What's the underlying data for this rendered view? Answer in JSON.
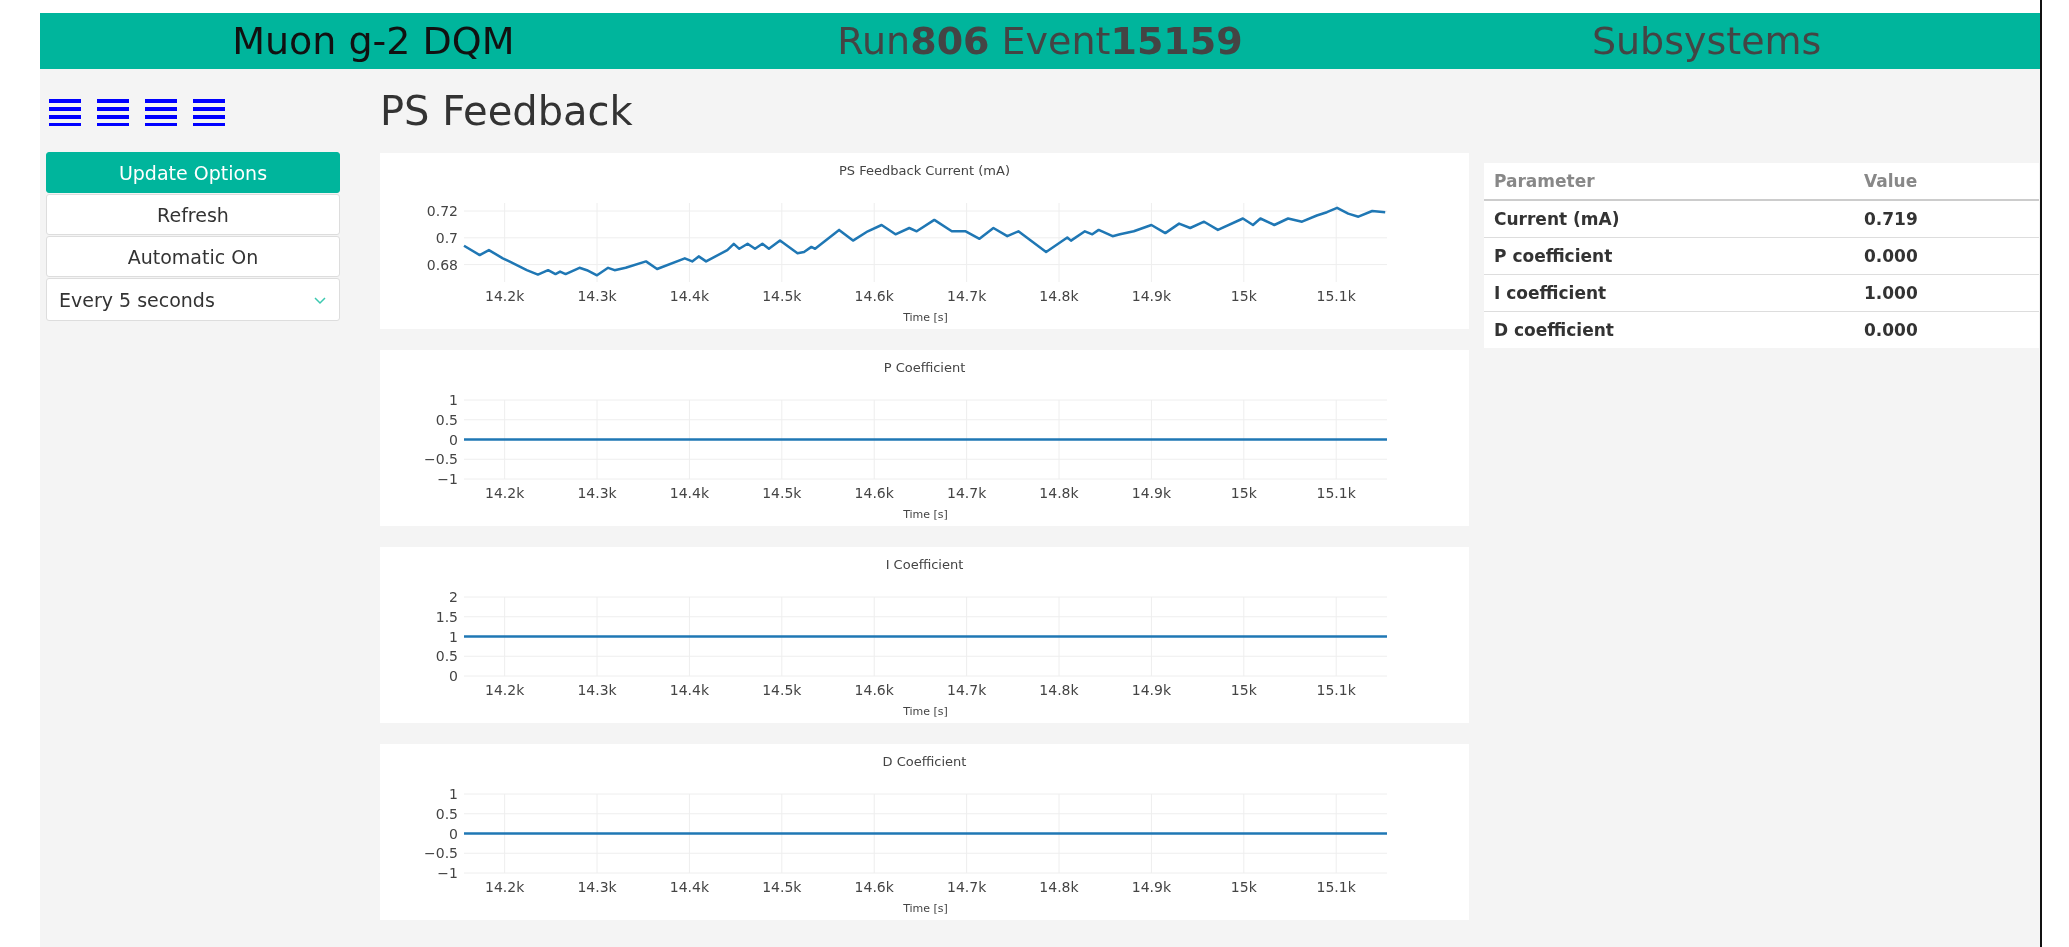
{
  "header": {
    "title": "Muon g-2 DQM",
    "run_event": "Run**806** Event**15159**",
    "subsystems": "Subsystems"
  },
  "sidebar": {
    "buttons": [
      {
        "label": "Update Options",
        "kind": "primary"
      },
      {
        "label": "Refresh",
        "kind": "plain"
      },
      {
        "label": "Automatic On",
        "kind": "plain"
      }
    ],
    "interval_select": {
      "value": "Every 5 seconds"
    }
  },
  "page_title": "PS Feedback",
  "charts": [
    {
      "chart_data": {
        "type": "line",
        "grid": true,
        "title": "PS Feedback Current (mA)",
        "xlabel": "Time [s]",
        "xlim": [
          14156,
          15155
        ],
        "ylim": [
          0.667,
          0.726
        ],
        "xticks": [
          {
            "value": 14200,
            "label": "14.2k"
          },
          {
            "value": 14300,
            "label": "14.3k"
          },
          {
            "value": 14400,
            "label": "14.4k"
          },
          {
            "value": 14500,
            "label": "14.5k"
          },
          {
            "value": 14600,
            "label": "14.6k"
          },
          {
            "value": 14700,
            "label": "14.7k"
          },
          {
            "value": 14800,
            "label": "14.8k"
          },
          {
            "value": 14900,
            "label": "14.9k"
          },
          {
            "value": 15000,
            "label": "15k"
          },
          {
            "value": 15100,
            "label": "15.1k"
          }
        ],
        "yticks": [
          {
            "value": 0.68,
            "label": "0.68"
          },
          {
            "value": 0.7,
            "label": "0.7"
          },
          {
            "value": 0.72,
            "label": "0.72"
          }
        ],
        "x": [
          14156,
          14173,
          14183,
          14198,
          14205,
          14224,
          14236,
          14247,
          14255,
          14260,
          14266,
          14281,
          14289,
          14300,
          14312,
          14319,
          14331,
          14353,
          14365,
          14395,
          14403,
          14410,
          14418,
          14441,
          14448,
          14454,
          14463,
          14471,
          14479,
          14486,
          14498,
          14517,
          14524,
          14532,
          14536,
          14562,
          14577,
          14593,
          14608,
          14623,
          14638,
          14646,
          14665,
          14684,
          14699,
          14714,
          14729,
          14744,
          14756,
          14786,
          14809,
          14813,
          14828,
          14836,
          14843,
          14858,
          14866,
          14881,
          14900,
          14915,
          14930,
          14942,
          14957,
          14972,
          14999,
          15010,
          15018,
          15033,
          15048,
          15063,
          15079,
          15090,
          15101,
          15113,
          15124,
          15139,
          15153
        ],
        "series": [
          {
            "color": "#1f77b4",
            "values": [
              0.6941,
              0.6871,
              0.6908,
              0.6847,
              0.6824,
              0.6758,
              0.6725,
              0.6758,
              0.6729,
              0.6748,
              0.6729,
              0.6776,
              0.6758,
              0.672,
              0.6776,
              0.6758,
              0.6776,
              0.6824,
              0.6767,
              0.6847,
              0.6824,
              0.6861,
              0.6824,
              0.6908,
              0.6955,
              0.6918,
              0.6955,
              0.6918,
              0.6955,
              0.6918,
              0.6979,
              0.6885,
              0.6894,
              0.6932,
              0.6918,
              0.7059,
              0.6979,
              0.7049,
              0.7096,
              0.7026,
              0.7073,
              0.7049,
              0.7134,
              0.7049,
              0.7049,
              0.6993,
              0.7073,
              0.7012,
              0.7049,
              0.6894,
              0.7002,
              0.6979,
              0.7049,
              0.7026,
              0.7059,
              0.7012,
              0.7026,
              0.7049,
              0.7096,
              0.7035,
              0.7106,
              0.7073,
              0.712,
              0.7059,
              0.7144,
              0.7096,
              0.7144,
              0.7096,
              0.7144,
              0.712,
              0.7167,
              0.7191,
              0.7224,
              0.7181,
              0.7158,
              0.72,
              0.7191
            ]
          }
        ]
      }
    },
    {
      "chart_data": {
        "type": "line",
        "grid": true,
        "title": "P Coefficient",
        "xlabel": "Time [s]",
        "xlim": [
          14156,
          15155
        ],
        "ylim": [
          -1,
          1
        ],
        "xticks": [
          {
            "value": 14200,
            "label": "14.2k"
          },
          {
            "value": 14300,
            "label": "14.3k"
          },
          {
            "value": 14400,
            "label": "14.4k"
          },
          {
            "value": 14500,
            "label": "14.5k"
          },
          {
            "value": 14600,
            "label": "14.6k"
          },
          {
            "value": 14700,
            "label": "14.7k"
          },
          {
            "value": 14800,
            "label": "14.8k"
          },
          {
            "value": 14900,
            "label": "14.9k"
          },
          {
            "value": 15000,
            "label": "15k"
          },
          {
            "value": 15100,
            "label": "15.1k"
          }
        ],
        "yticks": [
          {
            "value": -1,
            "label": "−1"
          },
          {
            "value": -0.5,
            "label": "−0.5"
          },
          {
            "value": 0,
            "label": "0"
          },
          {
            "value": 0.5,
            "label": "0.5"
          },
          {
            "value": 1,
            "label": "1"
          }
        ],
        "x": [
          14156,
          15155
        ],
        "series": [
          {
            "color": "#1f77b4",
            "values": [
              0,
              0
            ]
          }
        ]
      }
    },
    {
      "chart_data": {
        "type": "line",
        "grid": true,
        "title": "I Coefficient",
        "xlabel": "Time [s]",
        "xlim": [
          14156,
          15155
        ],
        "ylim": [
          0,
          2
        ],
        "xticks": [
          {
            "value": 14200,
            "label": "14.2k"
          },
          {
            "value": 14300,
            "label": "14.3k"
          },
          {
            "value": 14400,
            "label": "14.4k"
          },
          {
            "value": 14500,
            "label": "14.5k"
          },
          {
            "value": 14600,
            "label": "14.6k"
          },
          {
            "value": 14700,
            "label": "14.7k"
          },
          {
            "value": 14800,
            "label": "14.8k"
          },
          {
            "value": 14900,
            "label": "14.9k"
          },
          {
            "value": 15000,
            "label": "15k"
          },
          {
            "value": 15100,
            "label": "15.1k"
          }
        ],
        "yticks": [
          {
            "value": 0,
            "label": "0"
          },
          {
            "value": 0.5,
            "label": "0.5"
          },
          {
            "value": 1,
            "label": "1"
          },
          {
            "value": 1.5,
            "label": "1.5"
          },
          {
            "value": 2,
            "label": "2"
          }
        ],
        "x": [
          14156,
          15155
        ],
        "series": [
          {
            "color": "#1f77b4",
            "values": [
              1,
              1
            ]
          }
        ]
      }
    },
    {
      "chart_data": {
        "type": "line",
        "grid": true,
        "title": "D Coefficient",
        "xlabel": "Time [s]",
        "xlim": [
          14156,
          15155
        ],
        "ylim": [
          -1,
          1
        ],
        "xticks": [
          {
            "value": 14200,
            "label": "14.2k"
          },
          {
            "value": 14300,
            "label": "14.3k"
          },
          {
            "value": 14400,
            "label": "14.4k"
          },
          {
            "value": 14500,
            "label": "14.5k"
          },
          {
            "value": 14600,
            "label": "14.6k"
          },
          {
            "value": 14700,
            "label": "14.7k"
          },
          {
            "value": 14800,
            "label": "14.8k"
          },
          {
            "value": 14900,
            "label": "14.9k"
          },
          {
            "value": 15000,
            "label": "15k"
          },
          {
            "value": 15100,
            "label": "15.1k"
          }
        ],
        "yticks": [
          {
            "value": -1,
            "label": "−1"
          },
          {
            "value": -0.5,
            "label": "−0.5"
          },
          {
            "value": 0,
            "label": "0"
          },
          {
            "value": 0.5,
            "label": "0.5"
          },
          {
            "value": 1,
            "label": "1"
          }
        ],
        "x": [
          14156,
          15155
        ],
        "series": [
          {
            "color": "#1f77b4",
            "values": [
              0,
              0
            ]
          }
        ]
      }
    }
  ],
  "table": {
    "columns": [
      "Parameter",
      "Value"
    ],
    "rows": [
      [
        "Current (mA)",
        "0.719"
      ],
      [
        "P coefficient",
        "0.000"
      ],
      [
        "I coefficient",
        "1.000"
      ],
      [
        "D coefficient",
        "0.000"
      ]
    ]
  }
}
